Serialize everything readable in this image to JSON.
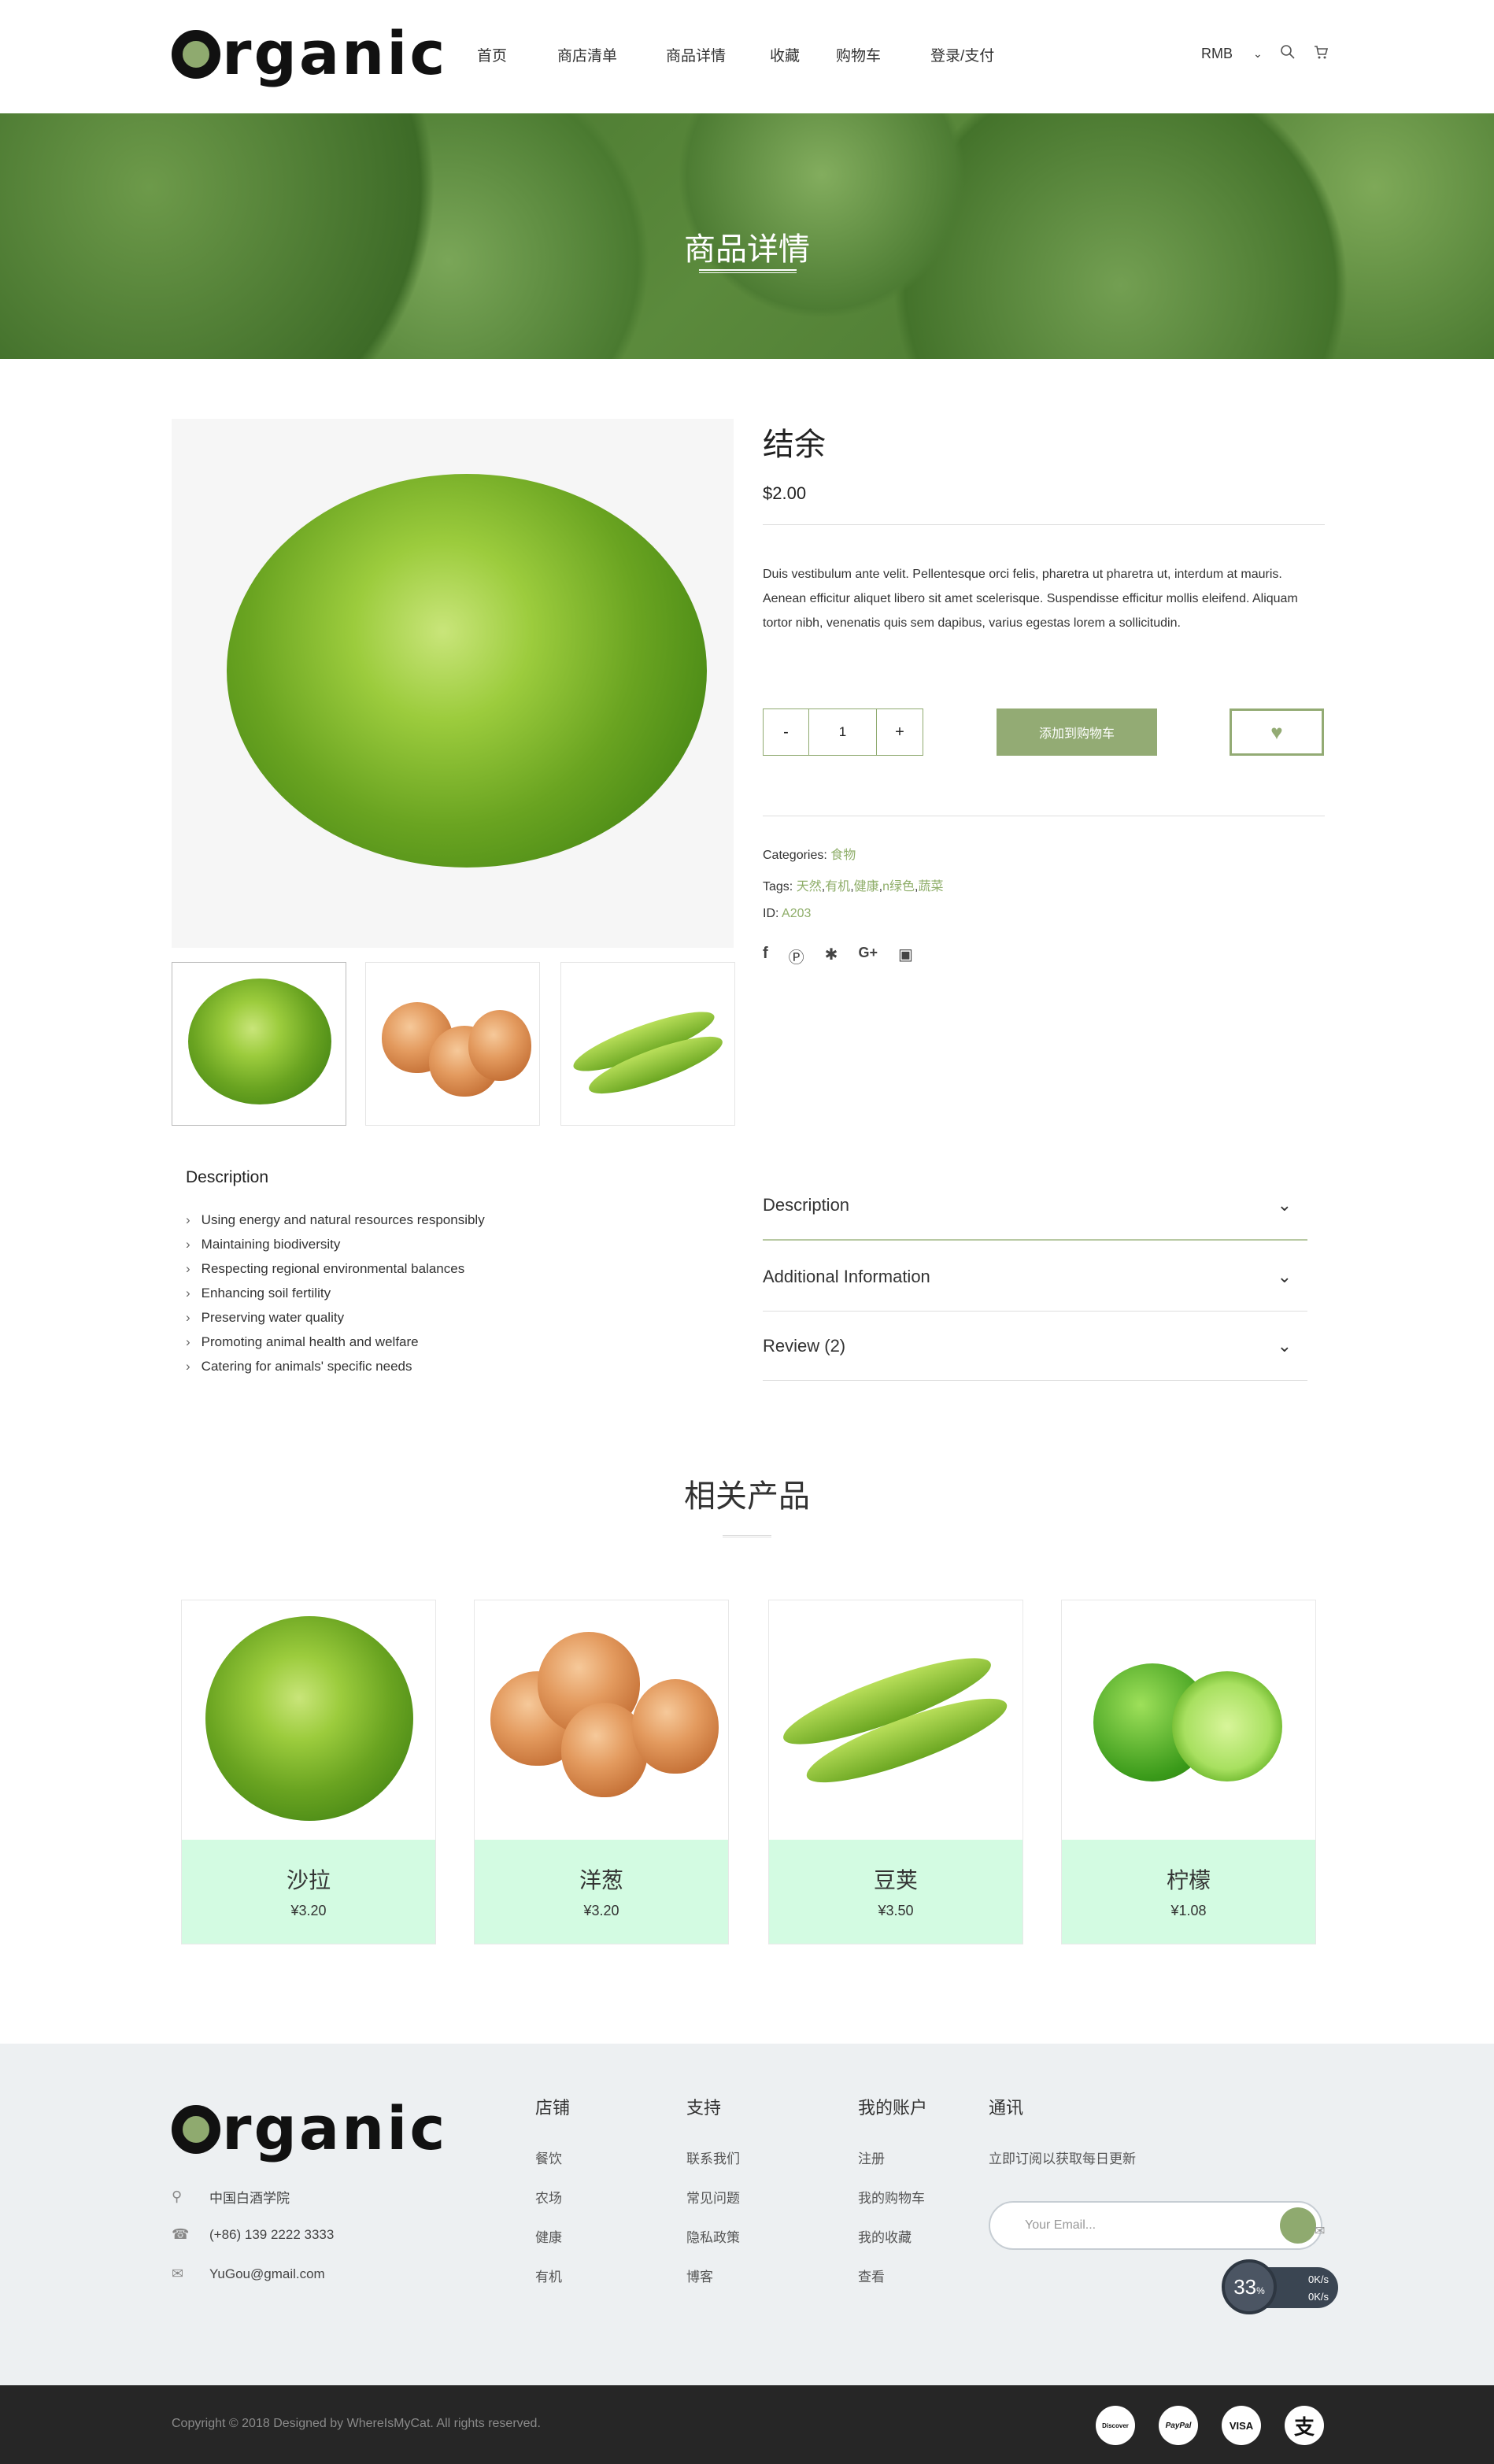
{
  "brand": {
    "logo_text": "rganic"
  },
  "nav": {
    "items": [
      "首页",
      "商店清单",
      "商品详情",
      "收藏",
      "购物车",
      "登录/支付"
    ]
  },
  "header": {
    "currency": "RMB",
    "currency_icon": "chevron-down-icon",
    "search_icon": "search-icon",
    "cart_icon": "cart-icon"
  },
  "banner": {
    "title": "商品详情"
  },
  "product": {
    "title": "结余",
    "price": "$2.00",
    "description": "Duis vestibulum ante velit. Pellentesque orci felis, pharetra ut pharetra ut, interdum at mauris. Aenean efficitur aliquet libero sit amet scelerisque. Suspendisse efficitur mollis eleifend. Aliquam tortor nibh, venenatis quis sem dapibus, varius egestas lorem a sollicitudin.",
    "qty_minus": "-",
    "qty_value": "1",
    "qty_plus": "+",
    "add_to_cart": "添加到购物车",
    "wish_icon": "♥",
    "categories_label": "Categories:",
    "category": "食物",
    "tags_label": "Tags:",
    "tags": [
      "天然",
      "有机",
      "健康",
      "n绿色",
      "蔬菜"
    ],
    "id_label": "ID:",
    "id": "A203",
    "social": [
      "facebook-icon",
      "pinterest-icon",
      "twitter-icon",
      "google-plus-icon",
      "instagram-icon"
    ]
  },
  "details": {
    "title": "Description",
    "items": [
      "Using energy and natural resources responsibly",
      "Maintaining biodiversity",
      "Respecting regional environmental balances",
      "Enhancing soil fertility",
      "Preserving water quality",
      "Promoting animal health and welfare",
      "Catering for animals' specific needs"
    ]
  },
  "accordion": {
    "items": [
      "Description",
      "Additional Information",
      "Review (2)"
    ]
  },
  "related": {
    "title": "相关产品",
    "products": [
      {
        "name": "沙拉",
        "price": "¥3.20"
      },
      {
        "name": "洋葱",
        "price": "¥3.20"
      },
      {
        "name": "豆荚",
        "price": "¥3.50"
      },
      {
        "name": "柠檬",
        "price": "¥1.08"
      }
    ]
  },
  "footer": {
    "address": "中国白酒学院",
    "phone": "(+86) 139 2222 3333",
    "email": "YuGou@gmail.com",
    "columns": [
      {
        "title": "店铺",
        "links": [
          "餐饮",
          "农场",
          "健康",
          "有机"
        ]
      },
      {
        "title": "支持",
        "links": [
          "联系我们",
          "常见问题",
          "隐私政策",
          "博客"
        ]
      },
      {
        "title": "我的账户",
        "links": [
          "注册",
          "我的购物车",
          "我的收藏",
          "查看"
        ]
      }
    ],
    "newsletter_title": "通讯",
    "newsletter_text": "立即订阅以获取每日更新",
    "email_placeholder": "Your Email...",
    "speed_percent": "33",
    "speed_unit": "%",
    "speed_up": "0K/s",
    "speed_down": "0K/s",
    "copyright": "Copyright © 2018 Designed by WhereIsMyCat. All rights reserved.",
    "payments": [
      "Discover",
      "PayPal",
      "VISA",
      "支"
    ]
  },
  "colors": {
    "accent": "#8faa6f",
    "related_card_bg": "#d3fbe2",
    "footer_bg": "#edf0f2",
    "bottom_bar": "#262626"
  }
}
